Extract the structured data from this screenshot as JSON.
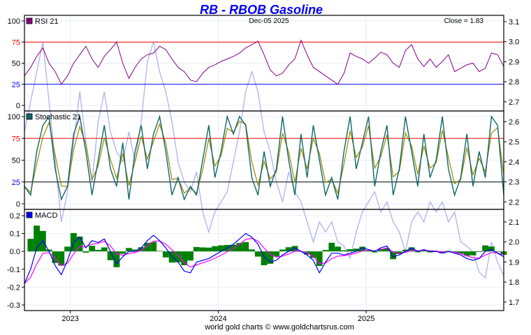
{
  "chart_data": {
    "type": "line",
    "title": "RB - RBOB Gasoline",
    "date_label": "Dec-05  2025",
    "close_label": "Close = 1.83",
    "footer": "world gold charts © www.goldchartsrus.com",
    "x_range": [
      2022.69,
      2025.93
    ],
    "x_ticks": [
      {
        "label": "2023",
        "value": 2023
      },
      {
        "label": "2024",
        "value": 2024
      },
      {
        "label": "2025",
        "value": 2025
      }
    ],
    "price_axis": {
      "range": [
        1.66,
        3.13
      ],
      "ticks": [
        "3.1",
        "3.0",
        "2.9",
        "2.8",
        "2.7",
        "2.6",
        "2.5",
        "2.4",
        "2.3",
        "2.2",
        "2.1",
        "2.0",
        "1.9",
        "1.8",
        "1.7"
      ]
    },
    "colors": {
      "title": "#0000ff",
      "price": "#a8a8f0",
      "rsi": "#880088",
      "stoch": "#116666",
      "stoch_signal": "#998800",
      "macd": "#0000ff",
      "signal": "#ff00ff",
      "hist": "#008000",
      "upper": "#ff0000",
      "lower_rsi": "#0000ff",
      "grid": "#e4eefa"
    },
    "price": [
      2.55,
      2.7,
      2.85,
      3.0,
      2.7,
      2.4,
      2.1,
      2.25,
      2.5,
      2.75,
      2.5,
      2.3,
      2.6,
      2.75,
      2.55,
      2.45,
      2.4,
      2.55,
      2.4,
      2.6,
      2.9,
      3.0,
      2.85,
      2.75,
      2.6,
      2.4,
      2.3,
      2.25,
      2.35,
      2.15,
      2.05,
      2.15,
      2.2,
      2.25,
      2.4,
      2.55,
      2.75,
      2.85,
      2.75,
      2.55,
      2.45,
      2.3,
      2.2,
      2.35,
      2.25,
      2.2,
      2.1,
      2.0,
      2.1,
      2.05,
      2.1,
      2.0,
      1.98,
      1.92,
      2.05,
      2.15,
      2.2,
      2.25,
      2.15,
      2.2,
      2.1,
      2.05,
      1.95,
      2.1,
      2.15,
      2.1,
      2.2,
      2.15,
      2.2,
      2.1,
      2.15,
      2.0,
      1.98,
      1.95,
      1.85,
      1.82,
      2.0,
      1.9,
      1.83
    ],
    "panels": [
      {
        "name": "RSI 21",
        "legend_color": "#880088",
        "range": [
          0,
          100
        ],
        "ticks": [
          {
            "label": "100",
            "value": 100
          },
          {
            "label": "75",
            "value": 75,
            "color": "#ff0000"
          },
          {
            "label": "50",
            "value": 50
          },
          {
            "label": "25",
            "value": 25,
            "color": "#0000ff"
          },
          {
            "label": "0",
            "value": 0
          }
        ],
        "levels": [
          {
            "value": 75,
            "color": "#ff0000"
          },
          {
            "value": 25,
            "color": "#0000ff"
          }
        ],
        "values": [
          35,
          45,
          58,
          68,
          50,
          40,
          25,
          35,
          50,
          60,
          70,
          55,
          45,
          58,
          66,
          75,
          50,
          32,
          45,
          55,
          60,
          62,
          70,
          66,
          55,
          45,
          40,
          30,
          28,
          38,
          45,
          48,
          52,
          55,
          58,
          62,
          68,
          72,
          76,
          60,
          42,
          35,
          38,
          48,
          55,
          77,
          60,
          45,
          40,
          35,
          30,
          25,
          38,
          62,
          58,
          55,
          50,
          56,
          63,
          60,
          50,
          45,
          65,
          72,
          55,
          46,
          55,
          45,
          52,
          60,
          40,
          44,
          48,
          50,
          40,
          44,
          62,
          60,
          46
        ]
      },
      {
        "name": "Stochastic 21",
        "legend_color": "#116666",
        "range": [
          0,
          100
        ],
        "ticks": [
          {
            "label": "100",
            "value": 100
          },
          {
            "label": "75",
            "value": 75,
            "color": "#ff0000"
          },
          {
            "label": "50",
            "value": 50
          },
          {
            "label": "25",
            "value": 25,
            "color": "#0000ff"
          },
          {
            "label": "0",
            "value": 0
          }
        ],
        "levels": [
          {
            "value": 75,
            "color": "#ff0000"
          },
          {
            "value": 25,
            "color": "#000000"
          }
        ],
        "values": [
          20,
          10,
          60,
          90,
          100,
          40,
          5,
          20,
          80,
          100,
          60,
          10,
          50,
          90,
          40,
          20,
          70,
          5,
          60,
          90,
          40,
          80,
          100,
          60,
          10,
          30,
          5,
          20,
          10,
          50,
          90,
          30,
          60,
          100,
          80,
          100,
          90,
          30,
          10,
          60,
          20,
          40,
          100,
          50,
          10,
          80,
          30,
          90,
          50,
          10,
          30,
          5,
          60,
          100,
          40,
          70,
          100,
          20,
          60,
          90,
          10,
          40,
          100,
          60,
          20,
          80,
          30,
          50,
          100,
          40,
          10,
          30,
          80,
          20,
          60,
          30,
          100,
          90,
          10
        ]
      },
      {
        "name": "MACD",
        "legend_color": "#0000ff",
        "range": [
          -0.33,
          0.23
        ],
        "ticks": [
          {
            "label": "0.2",
            "value": 0.2
          },
          {
            "label": "0.1",
            "value": 0.1
          },
          {
            "label": "0.0",
            "value": 0
          },
          {
            "label": "-0.1",
            "value": -0.1
          },
          {
            "label": "-0.2",
            "value": -0.2
          },
          {
            "label": "-0.3",
            "value": -0.3
          }
        ],
        "levels": [],
        "values": [
          -0.18,
          -0.1,
          0.02,
          0.06,
          0.0,
          -0.08,
          -0.13,
          -0.05,
          0.05,
          0.08,
          0.02,
          0.06,
          0.05,
          0.07,
          0.0,
          -0.07,
          -0.03,
          0.0,
          0.0,
          0.02,
          0.06,
          0.09,
          0.06,
          0.02,
          -0.03,
          -0.06,
          -0.11,
          -0.12,
          -0.06,
          -0.05,
          -0.04,
          -0.02,
          0.0,
          0.02,
          0.04,
          0.07,
          0.1,
          0.08,
          0.04,
          -0.03,
          -0.06,
          -0.05,
          -0.02,
          0.0,
          0.02,
          0.0,
          -0.02,
          -0.05,
          -0.12,
          -0.06,
          -0.01,
          -0.01,
          -0.02,
          -0.01,
          0.0,
          0.02,
          0.01,
          0.0,
          0.02,
          0.03,
          -0.03,
          -0.02,
          0.0,
          0.02,
          0.0,
          0.01,
          0.0,
          0.0,
          -0.01,
          0.0,
          -0.01,
          -0.02,
          -0.04,
          -0.05,
          -0.04,
          0.0,
          0.01,
          -0.01,
          -0.03
        ]
      }
    ]
  }
}
